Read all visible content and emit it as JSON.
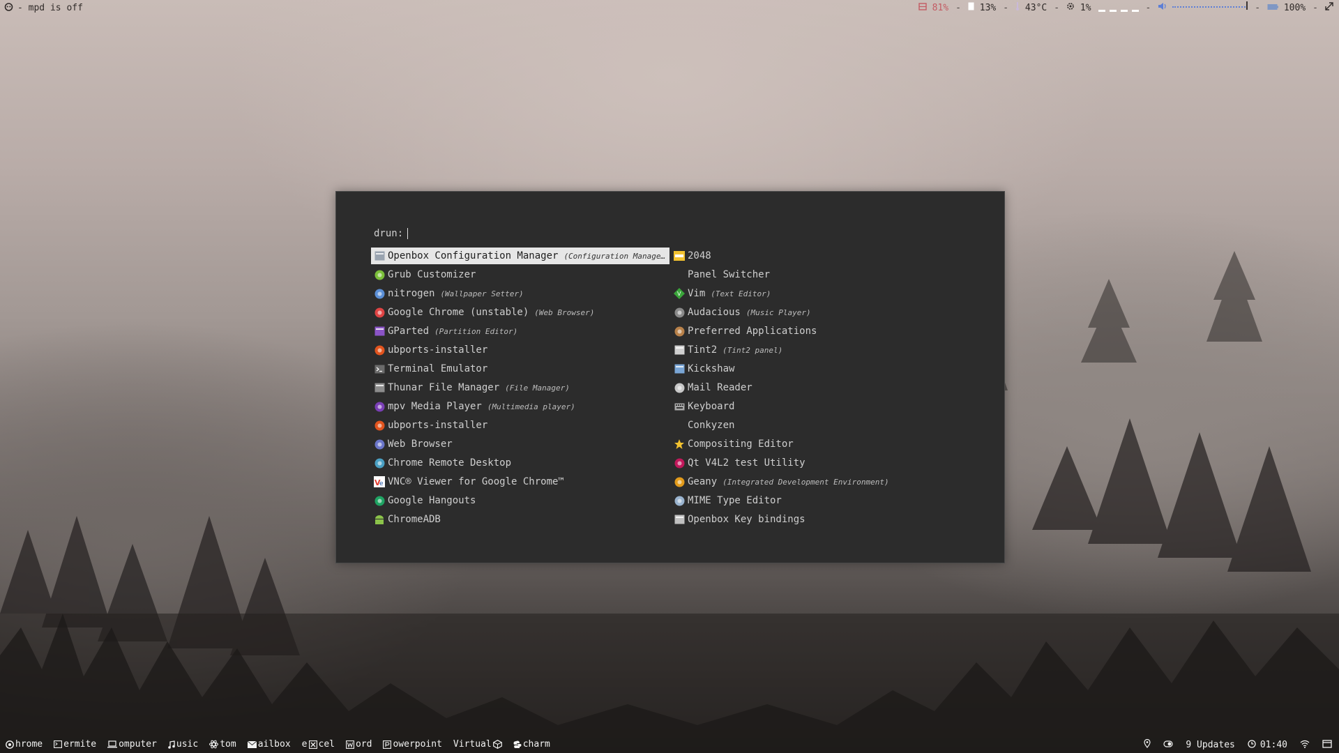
{
  "topbar": {
    "status_left": "- mpd is off",
    "cpu": "81%",
    "mem": "13%",
    "temp": "43°C",
    "disk": "1%",
    "brightness": "100%",
    "dash": "-"
  },
  "launcher": {
    "prompt": "drun:",
    "entries_left": [
      {
        "name": "Openbox Configuration Manager",
        "sub": "(Configuration Manage…",
        "icon": "openbox-config-icon",
        "color": "#9aa4b0",
        "selected": true
      },
      {
        "name": "Grub Customizer",
        "sub": "",
        "icon": "grub-icon",
        "color": "#7bbf3a"
      },
      {
        "name": "nitrogen",
        "sub": "(Wallpaper Setter)",
        "icon": "nitrogen-icon",
        "color": "#5b8fd6"
      },
      {
        "name": "Google Chrome (unstable)",
        "sub": "(Web Browser)",
        "icon": "chrome-icon",
        "color": "#e04444"
      },
      {
        "name": "GParted",
        "sub": "(Partition Editor)",
        "icon": "gparted-icon",
        "color": "#8b54c7"
      },
      {
        "name": "ubports-installer",
        "sub": "",
        "icon": "ubports-icon",
        "color": "#e2541e"
      },
      {
        "name": "Terminal Emulator",
        "sub": "",
        "icon": "terminal-icon",
        "color": "#6b6b6b"
      },
      {
        "name": "Thunar File Manager",
        "sub": "(File Manager)",
        "icon": "thunar-icon",
        "color": "#8c8c8c"
      },
      {
        "name": "mpv Media Player",
        "sub": "(Multimedia player)",
        "icon": "mpv-icon",
        "color": "#7a3fb5"
      },
      {
        "name": "ubports-installer",
        "sub": "",
        "icon": "ubports-icon",
        "color": "#e2541e"
      },
      {
        "name": "Web Browser",
        "sub": "",
        "icon": "web-browser-icon",
        "color": "#6a75c9"
      },
      {
        "name": "Chrome Remote Desktop",
        "sub": "",
        "icon": "remote-desktop-icon",
        "color": "#4aa0c4"
      },
      {
        "name": "VNC® Viewer for Google Chrome™",
        "sub": "",
        "icon": "vnc-icon",
        "color": "#e23b2e"
      },
      {
        "name": "Google Hangouts",
        "sub": "",
        "icon": "hangouts-icon",
        "color": "#1fa463"
      },
      {
        "name": "ChromeADB",
        "sub": "",
        "icon": "android-icon",
        "color": "#8bc34a"
      }
    ],
    "entries_right": [
      {
        "name": "2048",
        "sub": "",
        "icon": "game-2048-icon",
        "color": "#f2c230"
      },
      {
        "name": "Panel Switcher",
        "sub": "",
        "icon": "",
        "color": ""
      },
      {
        "name": "Vim",
        "sub": "(Text Editor)",
        "icon": "vim-icon",
        "color": "#3aa63a"
      },
      {
        "name": "Audacious",
        "sub": "(Music Player)",
        "icon": "audacious-icon",
        "color": "#8a8a8a"
      },
      {
        "name": "Preferred Applications",
        "sub": "",
        "icon": "preferred-apps-icon",
        "color": "#b9824a"
      },
      {
        "name": "Tint2",
        "sub": "(Tint2 panel)",
        "icon": "tint2-icon",
        "color": "#d0d0d0"
      },
      {
        "name": "Kickshaw",
        "sub": "",
        "icon": "kickshaw-icon",
        "color": "#7aa6d6"
      },
      {
        "name": "Mail Reader",
        "sub": "",
        "icon": "mail-icon",
        "color": "#c8c8c8"
      },
      {
        "name": "Keyboard",
        "sub": "",
        "icon": "keyboard-icon",
        "color": "#a8a8a8"
      },
      {
        "name": "Conkyzen",
        "sub": "",
        "icon": "",
        "color": ""
      },
      {
        "name": "Compositing Editor",
        "sub": "",
        "icon": "star-icon",
        "color": "#f2c230"
      },
      {
        "name": "Qt V4L2 test Utility",
        "sub": "",
        "icon": "qv4l2-icon",
        "color": "#c2185b"
      },
      {
        "name": "Geany",
        "sub": "(Integrated Development Environment)",
        "icon": "geany-icon",
        "color": "#e39b1b"
      },
      {
        "name": "MIME Type Editor",
        "sub": "",
        "icon": "mime-icon",
        "color": "#9ab4cf"
      },
      {
        "name": "Openbox Key bindings",
        "sub": "",
        "icon": "keybindings-icon",
        "color": "#c0c0c0"
      }
    ]
  },
  "taskbar": {
    "items": [
      {
        "label": "hrome",
        "icon": "chrome-icon"
      },
      {
        "label": "ermite",
        "icon": "terminal-icon"
      },
      {
        "label": "omputer",
        "icon": "laptop-icon"
      },
      {
        "label": "usic",
        "icon": "music-note-icon"
      },
      {
        "label": "tom",
        "icon": "atom-icon"
      },
      {
        "label": "ailbox",
        "icon": "envelope-icon"
      },
      {
        "label": "e",
        "label2": "cel",
        "icon": "excel-icon"
      },
      {
        "label": "ord",
        "icon": "word-icon"
      },
      {
        "label": "owerpoint",
        "icon": "powerpoint-icon"
      },
      {
        "label": "Virtual",
        "icon": "virtualbox-icon"
      },
      {
        "label": "charm",
        "icon": "pycharm-icon"
      }
    ],
    "updates": "9 Updates",
    "clock": "01:40"
  }
}
